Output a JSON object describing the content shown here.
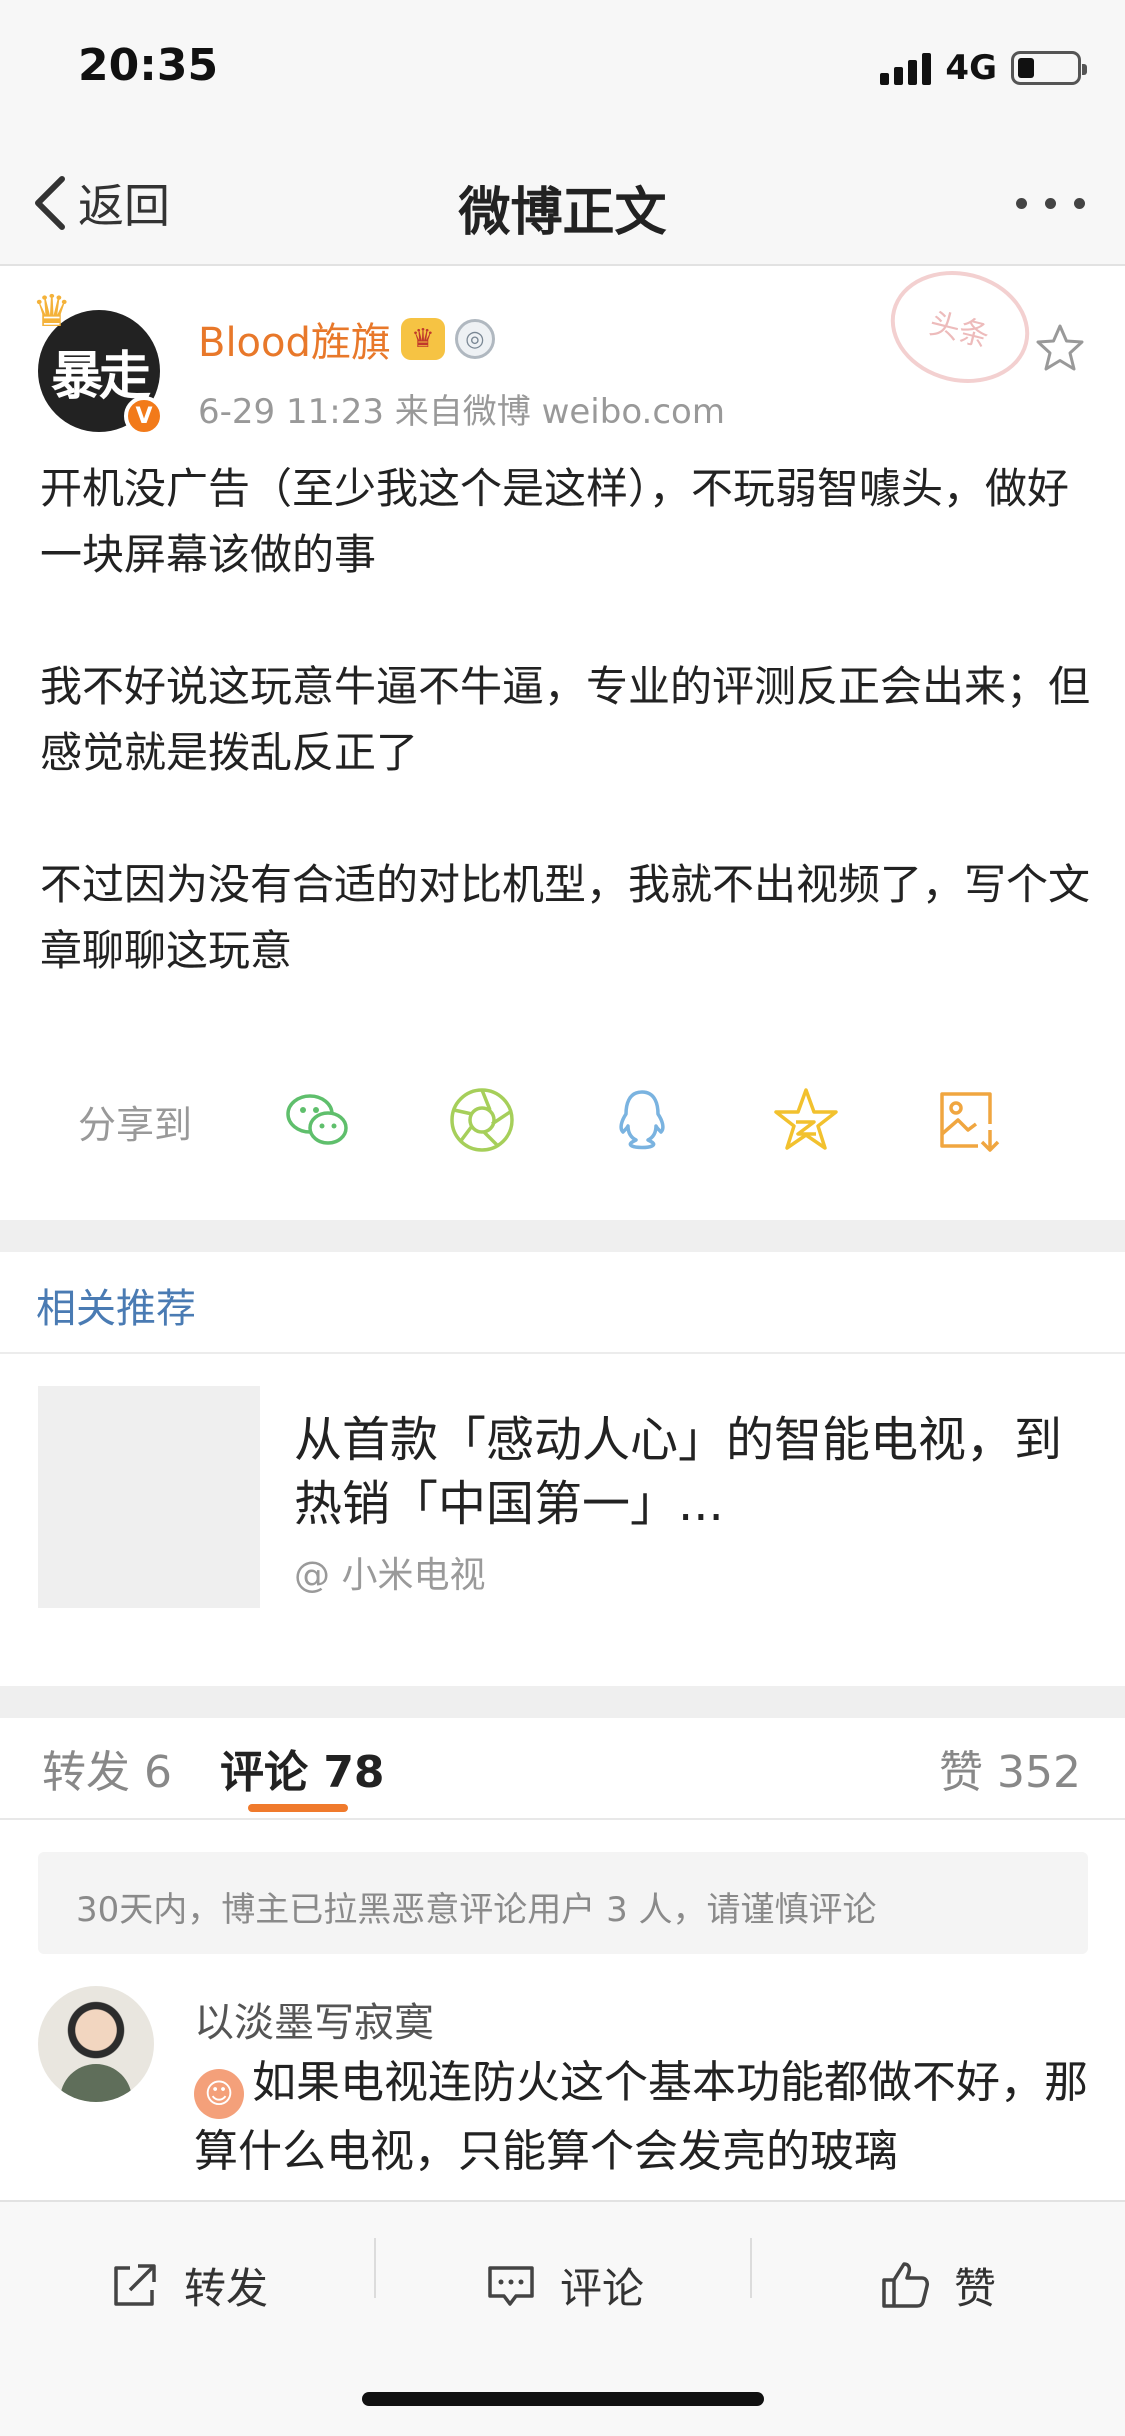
{
  "status_bar": {
    "time": "20:35",
    "network": "4G",
    "battery_level": 0.28
  },
  "nav": {
    "back_label": "返回",
    "title": "微博正文"
  },
  "post": {
    "username": "Blood旌旗",
    "avatar_text": "暴走",
    "verified_mark": "V",
    "meta": "6-29 11:23  来自微博 weibo.com",
    "stamp_text": "头条",
    "paragraphs": [
      "开机没广告（至少我这个是这样），不玩弱智噱头，做好一块屏幕该做的事",
      "我不好说这玩意牛逼不牛逼，专业的评测反正会出来；但感觉就是拨乱反正了",
      "不过因为没有合适的对比机型，我就不出视频了，写个文章聊聊这玩意"
    ],
    "share_label": "分享到",
    "share_targets": [
      "wechat-icon",
      "moments-icon",
      "qq-icon",
      "qzone-icon",
      "save-image-icon"
    ]
  },
  "recommend": {
    "section_title": "相关推荐",
    "headline": "从首款「感动人心」的智能电视，到热销「中国第一」...",
    "source": "@ 小米电视"
  },
  "tabs": {
    "repost": "转发 6",
    "comment": "评论 78",
    "like": "赞 352"
  },
  "comments": {
    "notice": "30天内，博主已拉黑恶意评论用户 3 人，请谨慎评论",
    "items": [
      {
        "name": "以淡墨写寂寞",
        "text": "如果电视连防火这个基本功能都做不好，那算什么电视，只能算个会发亮的玻璃"
      }
    ]
  },
  "toolbar": {
    "repost_label": "转发",
    "comment_label": "评论",
    "like_label": "赞"
  },
  "colors": {
    "username": "#e8782a",
    "link_blue": "#4a7bb3",
    "tab_accent": "#f07a2c",
    "wechat_green": "#5fbf6c",
    "qq_blue": "#7ab3e0",
    "star_yellow": "#f2c12e"
  }
}
